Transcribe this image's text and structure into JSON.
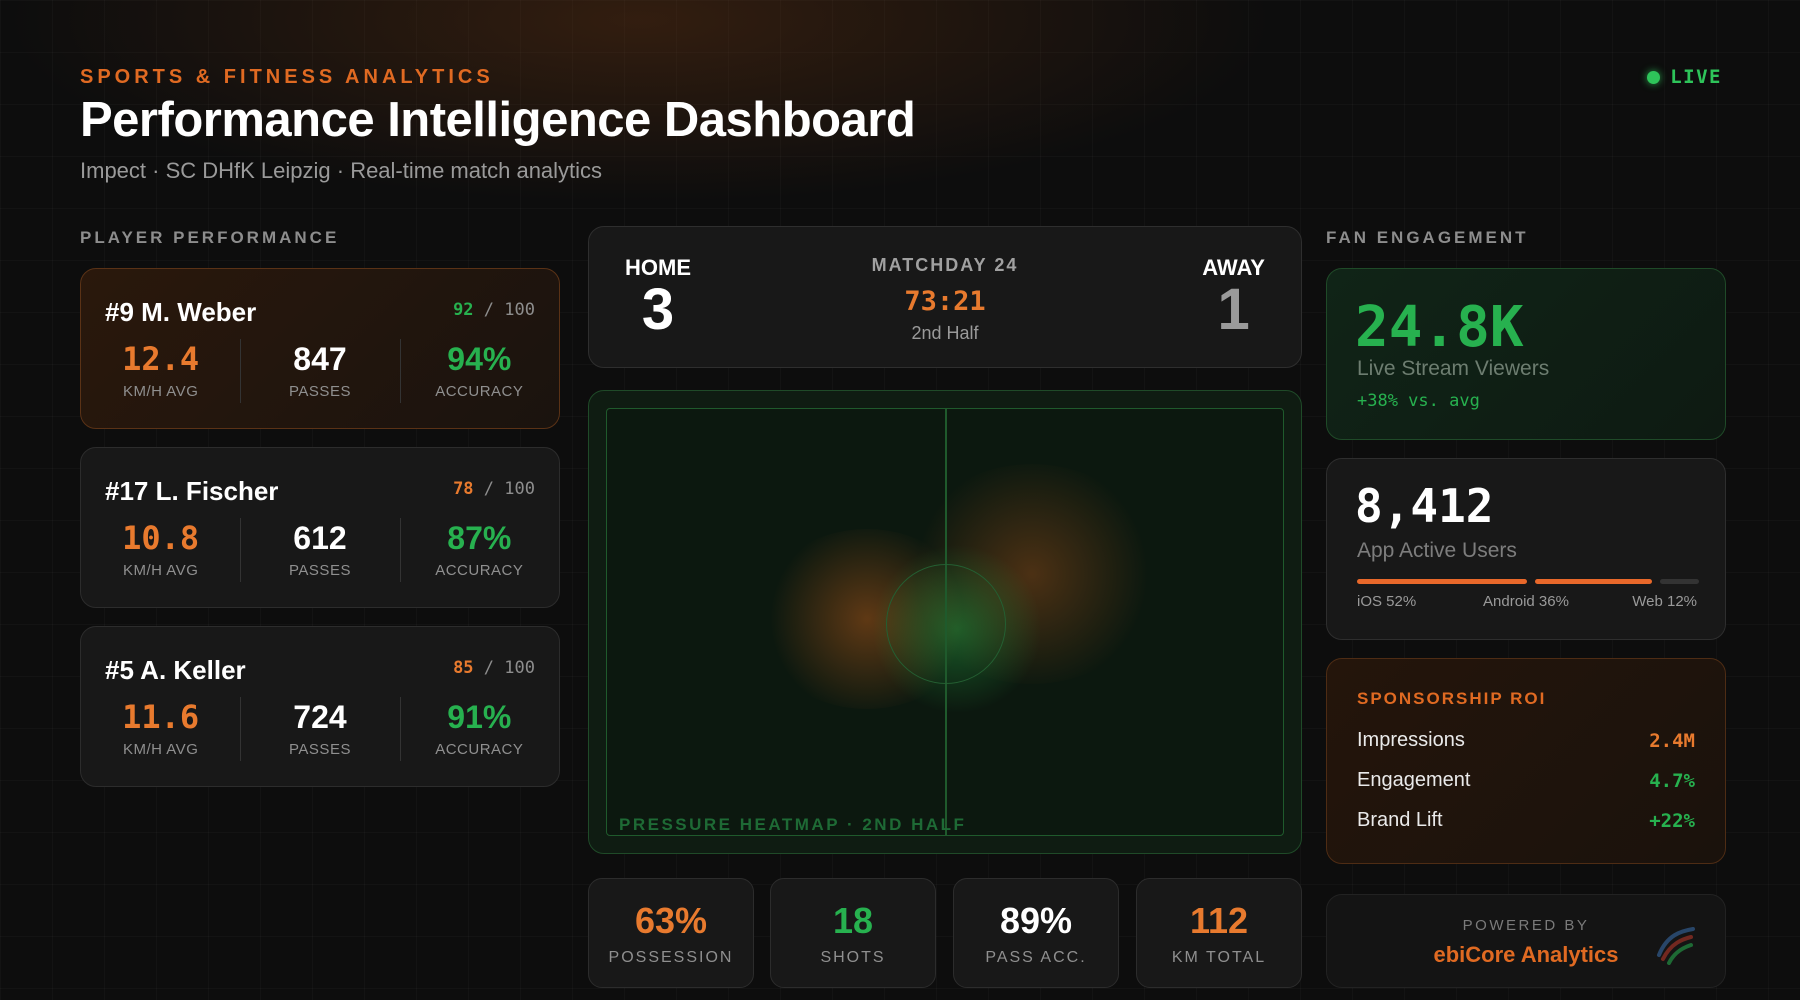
{
  "header": {
    "eyebrow": "SPORTS & FITNESS ANALYTICS",
    "title": "Performance Intelligence Dashboard",
    "subtitle": "Impect · SC DHfK Leipzig · Real-time match analytics",
    "live_label": "LIVE"
  },
  "players_section": {
    "label": "PLAYER PERFORMANCE",
    "players": [
      {
        "name": "#9 M. Weber",
        "score": "92",
        "score_max": "100",
        "speed": "12.4",
        "speed_label": "KM/H AVG",
        "passes": "847",
        "passes_label": "PASSES",
        "accuracy": "94%",
        "accuracy_label": "ACCURACY"
      },
      {
        "name": "#17 L. Fischer",
        "score": "78",
        "score_max": "100",
        "speed": "10.8",
        "speed_label": "KM/H AVG",
        "passes": "612",
        "passes_label": "PASSES",
        "accuracy": "87%",
        "accuracy_label": "ACCURACY"
      },
      {
        "name": "#5 A. Keller",
        "score": "85",
        "score_max": "100",
        "speed": "11.6",
        "speed_label": "KM/H AVG",
        "passes": "724",
        "passes_label": "PASSES",
        "accuracy": "91%",
        "accuracy_label": "ACCURACY"
      }
    ]
  },
  "scoreboard": {
    "home_label": "HOME",
    "home_score": "3",
    "away_label": "AWAY",
    "away_score": "1",
    "matchday": "MATCHDAY 24",
    "clock": "73:21",
    "half": "2nd Half"
  },
  "heatmap": {
    "label": "PRESSURE HEATMAP · 2ND HALF"
  },
  "match_stats": [
    {
      "value": "63%",
      "label": "POSSESSION",
      "color": "#e87a2e"
    },
    {
      "value": "18",
      "label": "SHOTS",
      "color": "#27b14f"
    },
    {
      "value": "89%",
      "label": "PASS ACC.",
      "color": "#ffffff"
    },
    {
      "value": "112",
      "label": "KM TOTAL",
      "color": "#e87a2e"
    }
  ],
  "fan_section": {
    "label": "FAN ENGAGEMENT",
    "viewers": {
      "value": "24.8K",
      "label": "Live Stream Viewers",
      "delta": "+38% vs. avg"
    },
    "app_users": {
      "value": "8,412",
      "label": "App Active Users",
      "platforms": [
        {
          "label": "iOS 52%",
          "share": 0.52,
          "color": "#e8682a"
        },
        {
          "label": "Android 36%",
          "share": 0.36,
          "color": "#e8682a"
        },
        {
          "label": "Web 12%",
          "share": 0.12,
          "color": "#333333"
        }
      ]
    },
    "sponsorship": {
      "label": "SPONSORSHIP ROI",
      "rows": [
        {
          "key": "Impressions",
          "value": "2.4M",
          "color": "#e87a2e"
        },
        {
          "key": "Engagement",
          "value": "4.7%",
          "color": "#27b14f"
        },
        {
          "key": "Brand Lift",
          "value": "+22%",
          "color": "#27b14f"
        }
      ]
    }
  },
  "footer": {
    "powered_by": "POWERED BY",
    "brand": "ebiCore Analytics"
  },
  "colors": {
    "accent_orange": "#e87a2e",
    "accent_green": "#27b14f",
    "background": "#0d0d0d"
  }
}
